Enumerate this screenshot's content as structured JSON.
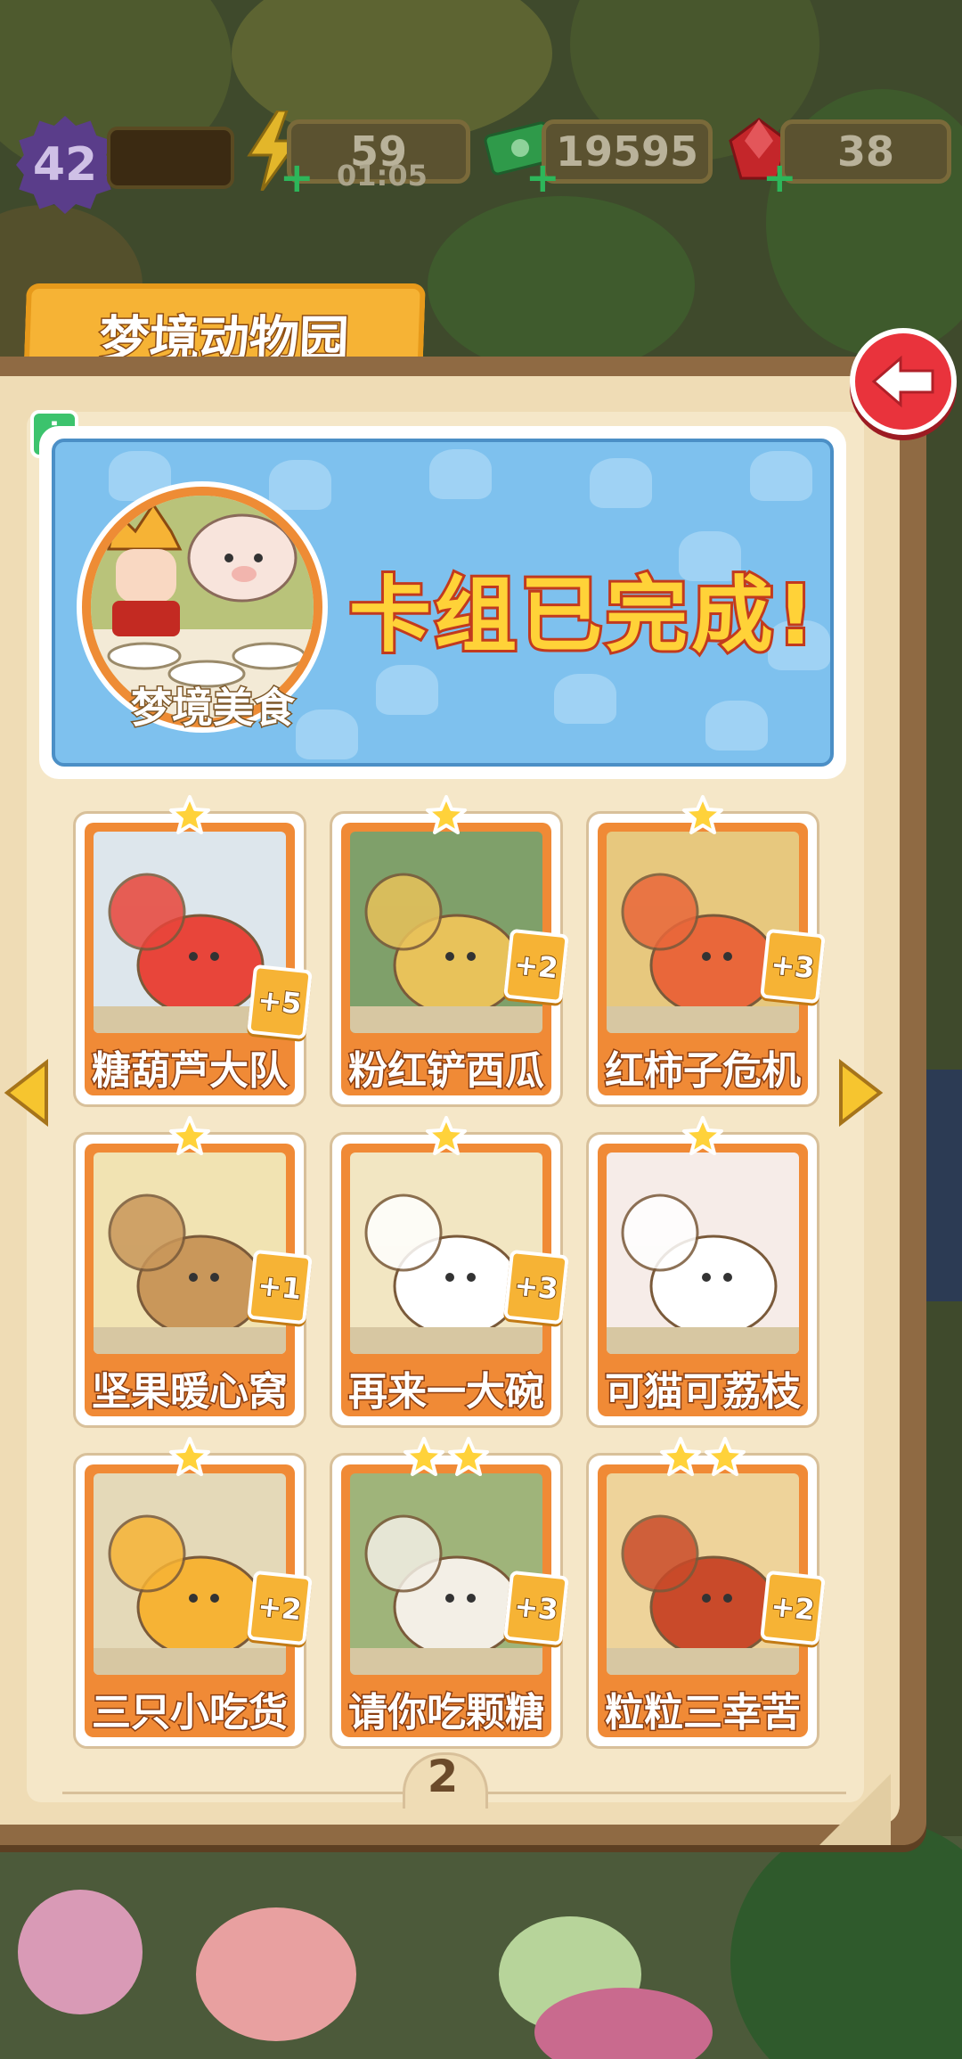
{
  "resources": {
    "level": "42",
    "energy": "59",
    "energy_timer": "01:05",
    "cash": "19595",
    "gems": "38"
  },
  "album": {
    "title": "梦境动物园",
    "set_name": "梦境美食",
    "status": "卡组已完成!",
    "page": "2"
  },
  "cards": [
    {
      "name": "糖葫芦大队",
      "count": "+5",
      "stars": 1
    },
    {
      "name": "粉红铲西瓜",
      "count": "+2",
      "stars": 1
    },
    {
      "name": "红柿子危机",
      "count": "+3",
      "stars": 1
    },
    {
      "name": "坚果暖心窝",
      "count": "+1",
      "stars": 1
    },
    {
      "name": "再来一大碗",
      "count": "+3",
      "stars": 1
    },
    {
      "name": "可猫可荔枝",
      "count": "",
      "stars": 1
    },
    {
      "name": "三只小吃货",
      "count": "+2",
      "stars": 1
    },
    {
      "name": "请你吃颗糖",
      "count": "+3",
      "stars": 2
    },
    {
      "name": "粒粒三幸苦",
      "count": "+2",
      "stars": 2
    }
  ],
  "icons": {
    "level": "level-badge-icon",
    "energy": "lightning-icon",
    "cash": "cash-icon",
    "gems": "ruby-icon",
    "back": "back-arrow-icon",
    "info": "info-icon",
    "prev": "chevron-left-icon",
    "next": "chevron-right-icon"
  },
  "colors": {
    "card_frame": "#f08a36",
    "tab": "#f6b335",
    "banner": "#7ec1ee",
    "back_button": "#e9333c",
    "complete_text": "#ffd238"
  }
}
